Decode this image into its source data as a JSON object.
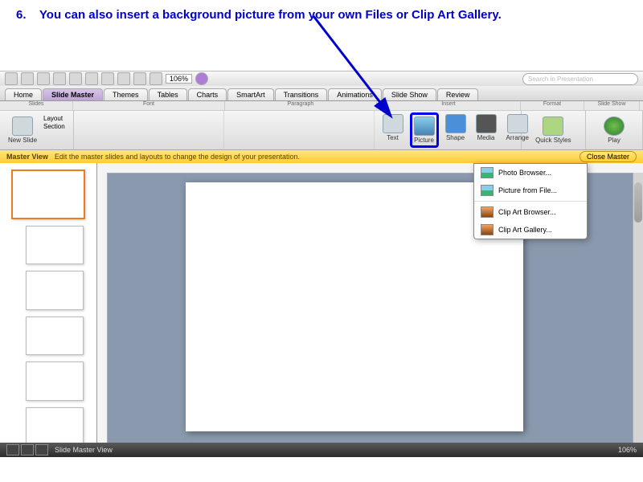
{
  "instruction": {
    "number": "6.",
    "text": "You can also insert a background picture from your own Files or Clip Art Gallery."
  },
  "quickbar": {
    "zoom": "106%",
    "search_placeholder": "Search in Presentation"
  },
  "tabs": [
    "Home",
    "Slide Master",
    "Themes",
    "Tables",
    "Charts",
    "SmartArt",
    "Transitions",
    "Animations",
    "Slide Show",
    "Review"
  ],
  "ribbon_sections": {
    "a": "Slides",
    "b": "Font",
    "c": "Paragraph",
    "d": "Insert",
    "e": "Format",
    "f": "Slide Show"
  },
  "slides_group": {
    "new_slide": "New Slide",
    "layout": "Layout",
    "section": "Section"
  },
  "insert_group": {
    "text": "Text",
    "picture": "Picture",
    "shape": "Shape",
    "media": "Media",
    "arrange": "Arrange"
  },
  "format_group": {
    "quick_styles": "Quick Styles"
  },
  "slideshow_group": {
    "play": "Play"
  },
  "master_bar": {
    "label": "Master View",
    "hint": "Edit the master slides and layouts to change the design of your presentation.",
    "close": "Close Master"
  },
  "dropdown": {
    "photo_browser": "Photo Browser...",
    "picture_from_file": "Picture from File...",
    "clip_art_browser": "Clip Art Browser...",
    "clip_art_gallery": "Clip Art Gallery..."
  },
  "status": {
    "view_label": "Slide Master View",
    "zoom": "106%"
  }
}
